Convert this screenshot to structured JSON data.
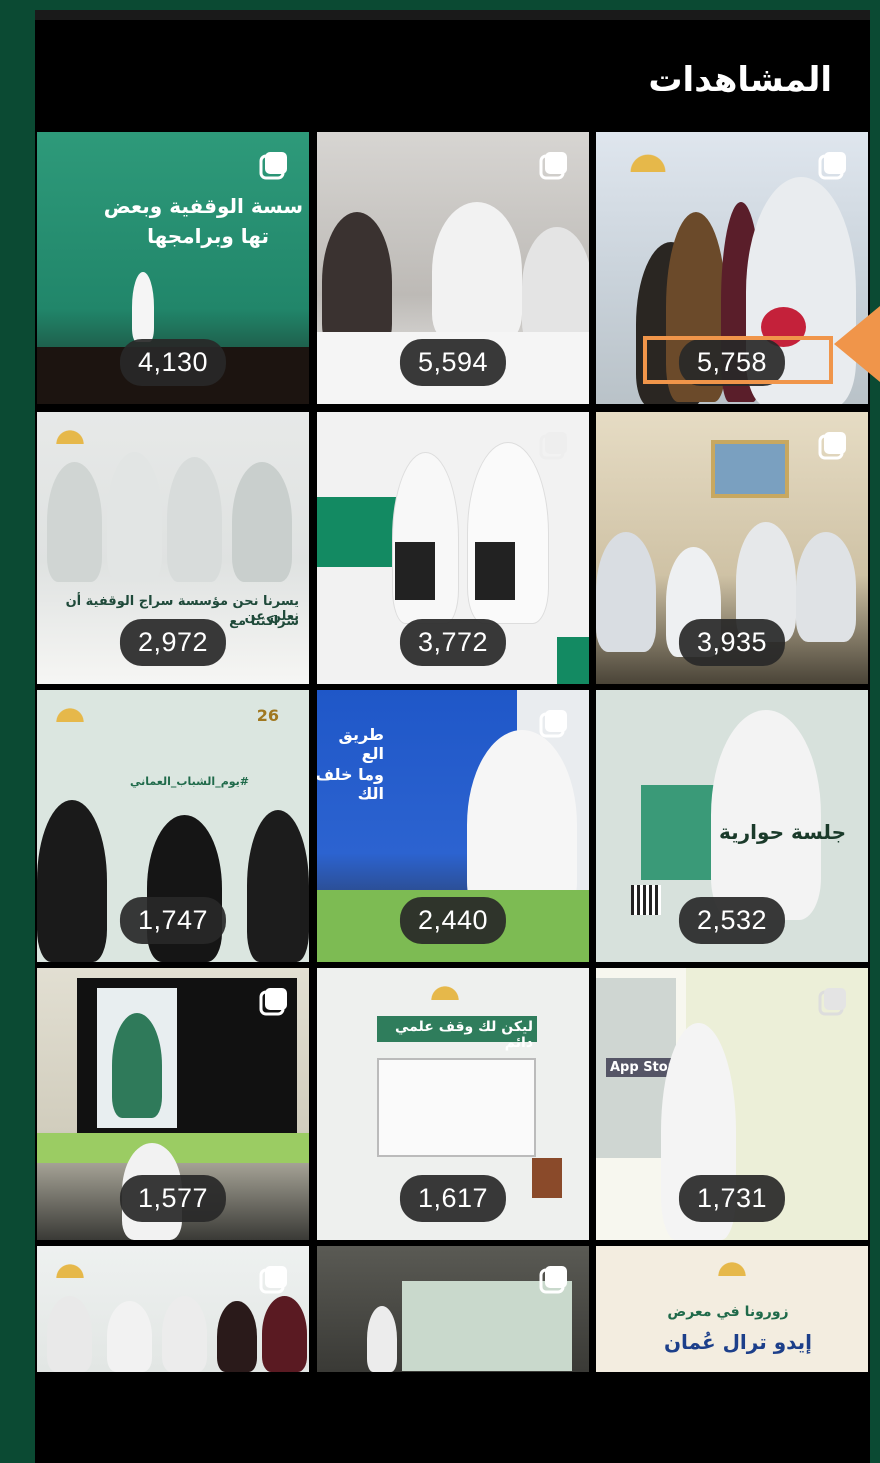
{
  "header": {
    "title": "المشاهدات"
  },
  "grid": {
    "tiles": [
      {
        "views": "5,758",
        "highlighted": true,
        "multi": true
      },
      {
        "views": "5,594",
        "multi": true
      },
      {
        "views": "4,130",
        "multi": true,
        "overlay_line1": "سسة الوقفية وبعض",
        "overlay_line2": "تها وبرامجها"
      },
      {
        "views": "3,935",
        "multi": true
      },
      {
        "views": "3,772",
        "multi": true
      },
      {
        "views": "2,972",
        "overlay_line1": "يسرنا نحن مؤسسة سراج الوقفية أن نعلن عن",
        "overlay_line2": "شراكتنا مع"
      },
      {
        "views": "2,532",
        "overlay_line1": "جلسة حوارية"
      },
      {
        "views": "2,440",
        "multi": true,
        "overlay_line1": "طريق الع",
        "overlay_line2": "وما خلف الك"
      },
      {
        "views": "1,747",
        "overlay_line1": "26",
        "overlay_line2": "#يوم_الشباب_العماني"
      },
      {
        "views": "1,731",
        "multi": true,
        "overlay_line1": "App Store"
      },
      {
        "views": "1,617",
        "overlay_line1": "ليكن لك وقف علمي دائم"
      },
      {
        "views": "1,577",
        "multi": true
      },
      {
        "views": "",
        "overlay_line1": "زورونا في معرض",
        "overlay_line2": "إيدو ترال عُمان"
      },
      {
        "views": "",
        "multi": true
      },
      {
        "views": "",
        "multi": true
      }
    ]
  },
  "colors": {
    "background": "#0b4a33",
    "highlight": "#f0954a",
    "badge": "#282828"
  }
}
